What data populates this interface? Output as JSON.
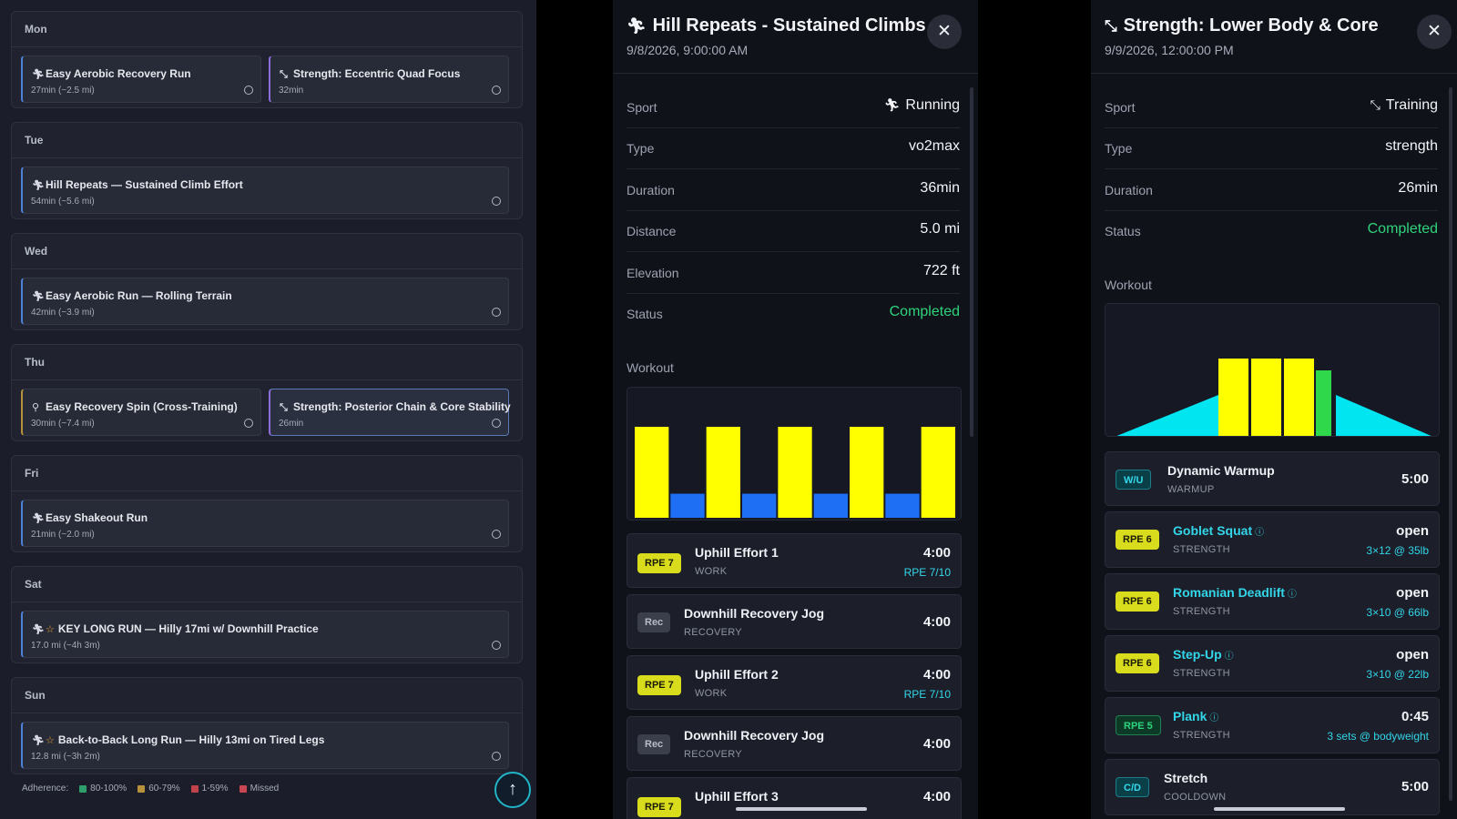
{
  "week": {
    "days": [
      {
        "name": "Mon",
        "sessions": [
          {
            "title": "Easy Aerobic Recovery Run",
            "meta": "27min (~2.5 mi)",
            "icon": "runner-icon"
          },
          {
            "title": "Strength: Eccentric Quad Focus",
            "meta": "32min",
            "icon": "strength-icon"
          }
        ]
      },
      {
        "name": "Tue",
        "sessions": [
          {
            "title": "Hill Repeats — Sustained Climb Effort",
            "meta": "54min (~5.6 mi)",
            "icon": "runner-icon"
          }
        ]
      },
      {
        "name": "Wed",
        "sessions": [
          {
            "title": "Easy Aerobic Run — Rolling Terrain",
            "meta": "42min (~3.9 mi)",
            "icon": "runner-icon"
          }
        ]
      },
      {
        "name": "Thu",
        "sessions": [
          {
            "title": "Easy Recovery Spin (Cross-Training)",
            "meta": "30min (~7.4 mi)",
            "icon": "bike-icon"
          },
          {
            "title": "Strength: Posterior Chain & Core Stability",
            "meta": "26min",
            "icon": "strength-icon"
          }
        ]
      },
      {
        "name": "Fri",
        "sessions": [
          {
            "title": "Easy Shakeout Run",
            "meta": "21min (~2.0 mi)",
            "icon": "runner-icon"
          }
        ]
      },
      {
        "name": "Sat",
        "sessions": [
          {
            "title": "KEY LONG RUN — Hilly 17mi w/ Downhill Practice",
            "meta": "17.0 mi (~4h 3m)",
            "icon": "runner-icon",
            "key": true
          }
        ]
      },
      {
        "name": "Sun",
        "sessions": [
          {
            "title": "Back-to-Back Long Run — Hilly 13mi on Tired Legs",
            "meta": "12.8 mi (~3h 2m)",
            "icon": "runner-icon",
            "key": true
          }
        ]
      }
    ],
    "legend": {
      "label": "Adherence:",
      "items": [
        {
          "label": "80-100%",
          "color": "#2f9f6a"
        },
        {
          "label": "60-79%",
          "color": "#b7923a"
        },
        {
          "label": "1-59%",
          "color": "#c0434a"
        },
        {
          "label": "Missed",
          "color": "#c94550"
        }
      ]
    },
    "scroll_top_glyph": "↑"
  },
  "run_detail": {
    "title": "Hill Repeats - Sustained Climbs",
    "datetime": "9/8/2026, 9:00:00 AM",
    "close_glyph": "✕",
    "fields": [
      {
        "key": "Sport",
        "value": "Running",
        "icon": "runner-icon"
      },
      {
        "key": "Type",
        "value": "vo2max"
      },
      {
        "key": "Duration",
        "value": "36min"
      },
      {
        "key": "Distance",
        "value": "5.0 mi"
      },
      {
        "key": "Elevation",
        "value": "722 ft"
      },
      {
        "key": "Status",
        "value": "Completed",
        "status": true
      }
    ],
    "workout_label": "Workout",
    "chart_bars": [
      {
        "kind": "work",
        "level": 0.68,
        "color": "#ffff00"
      },
      {
        "kind": "recovery",
        "level": 0.18,
        "color": "#1f6ff5"
      },
      {
        "kind": "work",
        "level": 0.68,
        "color": "#ffff00"
      },
      {
        "kind": "recovery",
        "level": 0.18,
        "color": "#1f6ff5"
      },
      {
        "kind": "work",
        "level": 0.68,
        "color": "#ffff00"
      },
      {
        "kind": "recovery",
        "level": 0.18,
        "color": "#1f6ff5"
      },
      {
        "kind": "work",
        "level": 0.68,
        "color": "#ffff00"
      },
      {
        "kind": "recovery",
        "level": 0.18,
        "color": "#1f6ff5"
      },
      {
        "kind": "work",
        "level": 0.68,
        "color": "#ffff00"
      }
    ],
    "steps": [
      {
        "badge": "RPE 7",
        "badge_kind": "rpe",
        "name": "Uphill Effort 1",
        "kind": "WORK",
        "value": "4:00",
        "sub": "RPE 7/10"
      },
      {
        "badge": "Rec",
        "badge_kind": "rec",
        "name": "Downhill Recovery Jog",
        "kind": "RECOVERY",
        "value": "4:00"
      },
      {
        "badge": "RPE 7",
        "badge_kind": "rpe",
        "name": "Uphill Effort 2",
        "kind": "WORK",
        "value": "4:00",
        "sub": "RPE 7/10"
      },
      {
        "badge": "Rec",
        "badge_kind": "rec",
        "name": "Downhill Recovery Jog",
        "kind": "RECOVERY",
        "value": "4:00"
      },
      {
        "badge": "RPE 7",
        "badge_kind": "rpe",
        "name": "Uphill Effort 3",
        "kind": "",
        "value": "4:00"
      }
    ]
  },
  "strength_detail": {
    "title": "Strength: Lower Body & Core",
    "datetime": "9/9/2026, 12:00:00 PM",
    "close_glyph": "✕",
    "fields": [
      {
        "key": "Sport",
        "value": "Training",
        "icon": "strength-icon"
      },
      {
        "key": "Type",
        "value": "strength"
      },
      {
        "key": "Duration",
        "value": "26min"
      },
      {
        "key": "Status",
        "value": "Completed",
        "status": true
      }
    ],
    "workout_label": "Workout",
    "chart_colors": {
      "ramp": "#00e5f0",
      "work": "#ffff00",
      "core": "#2fd84a"
    },
    "steps": [
      {
        "badge": "W/U",
        "badge_kind": "wu",
        "name": "Dynamic Warmup",
        "kind": "WARMUP",
        "value": "5:00"
      },
      {
        "badge": "RPE 6",
        "badge_kind": "g6",
        "name": "Goblet Squat",
        "kind": "STRENGTH",
        "value": "open",
        "sub": "3×12 @ 35lb",
        "link": true
      },
      {
        "badge": "RPE 6",
        "badge_kind": "g6",
        "name": "Romanian Deadlift",
        "kind": "STRENGTH",
        "value": "open",
        "sub": "3×10 @ 66lb",
        "link": true
      },
      {
        "badge": "RPE 6",
        "badge_kind": "g6",
        "name": "Step-Up",
        "kind": "STRENGTH",
        "value": "open",
        "sub": "3×10 @ 22lb",
        "link": true
      },
      {
        "badge": "RPE 5",
        "badge_kind": "g5",
        "name": "Plank",
        "kind": "STRENGTH",
        "value": "0:45",
        "sub": "3 sets @ bodyweight",
        "link": true
      },
      {
        "badge": "C/D",
        "badge_kind": "wu",
        "name": "Stretch",
        "kind": "COOLDOWN",
        "value": "5:00"
      }
    ]
  }
}
